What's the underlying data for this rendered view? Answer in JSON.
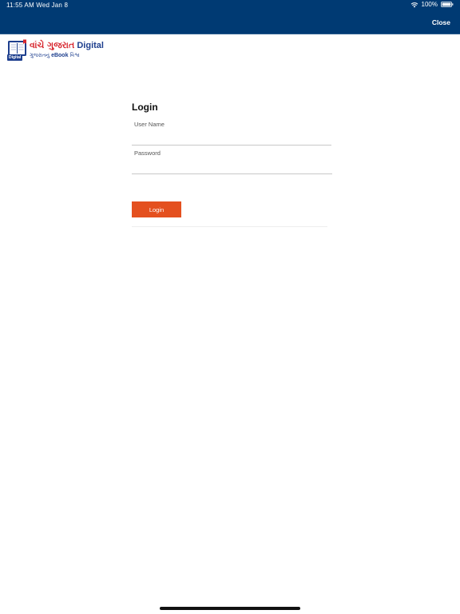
{
  "status_bar": {
    "time_date": "11:55 AM   Wed Jan 8",
    "battery": "100%"
  },
  "header": {
    "close_label": "Close",
    "color": "#003a73"
  },
  "logo": {
    "title_gujarati": "વાંચે ગુજરાત",
    "title_latin": "Digital",
    "badge": "Digital",
    "tagline_before": "ગુજરાતનું",
    "tagline_bold": "eBook",
    "tagline_after": "વિશ્વ"
  },
  "login": {
    "title": "Login",
    "username_label": "User Name",
    "username_value": "",
    "password_label": "Password",
    "password_value": "",
    "button_label": "Login",
    "button_color": "#e4501f"
  }
}
